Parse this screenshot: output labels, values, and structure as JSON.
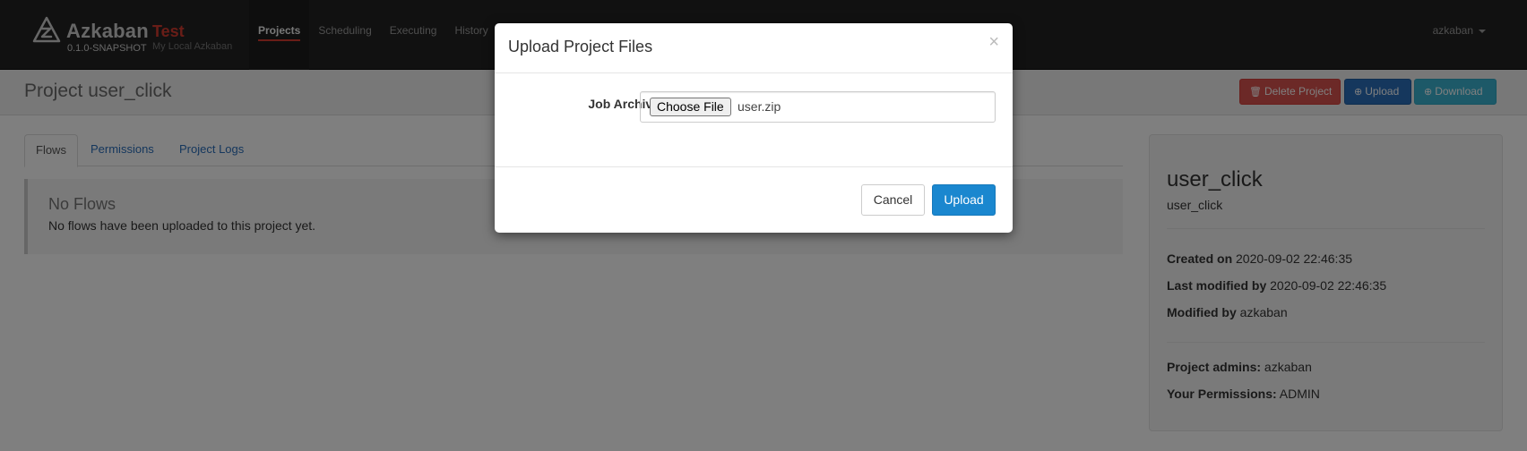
{
  "navbar": {
    "brand": "Azkaban",
    "environment": "Test",
    "version": "0.1.0-SNAPSHOT",
    "subtitle": "My Local Azkaban",
    "links": [
      "Projects",
      "Scheduling",
      "Executing",
      "History"
    ],
    "active_link": "Projects",
    "user": "azkaban"
  },
  "header": {
    "title": "Project user_click",
    "delete_label": "Delete Project",
    "upload_label": "Upload",
    "download_label": "Download"
  },
  "tabs": [
    "Flows",
    "Permissions",
    "Project Logs"
  ],
  "flows": {
    "title": "No Flows",
    "message": "No flows have been uploaded to this project yet."
  },
  "project_panel": {
    "name": "user_click",
    "description": "user_click",
    "created_label": "Created on",
    "created_value": "2020-09-02 22:46:35",
    "modified_label": "Last modified by",
    "modified_value": "2020-09-02 22:46:35",
    "modified_by_label": "Modified by",
    "modified_by_value": "azkaban",
    "admins_label": "Project admins:",
    "admins_value": "azkaban",
    "permissions_label": "Your Permissions:",
    "permissions_value": "ADMIN"
  },
  "modal": {
    "title": "Upload Project Files",
    "close_symbol": "×",
    "field_label": "Job Archive",
    "choose_file_label": "Choose File",
    "file_name": "user.zip",
    "cancel_label": "Cancel",
    "upload_label": "Upload"
  },
  "colors": {
    "navbar_bg": "#222222",
    "accent_red": "#d33b2f",
    "primary_blue": "#1a87cf",
    "danger": "#d9534f",
    "info": "#3bb3d0"
  },
  "icons": {
    "brand": "azkaban-logo-icon",
    "delete": "trash-icon",
    "upload": "upload-circle-icon",
    "download": "download-circle-icon",
    "close": "close-icon",
    "user_menu": "chevron-down-icon"
  }
}
